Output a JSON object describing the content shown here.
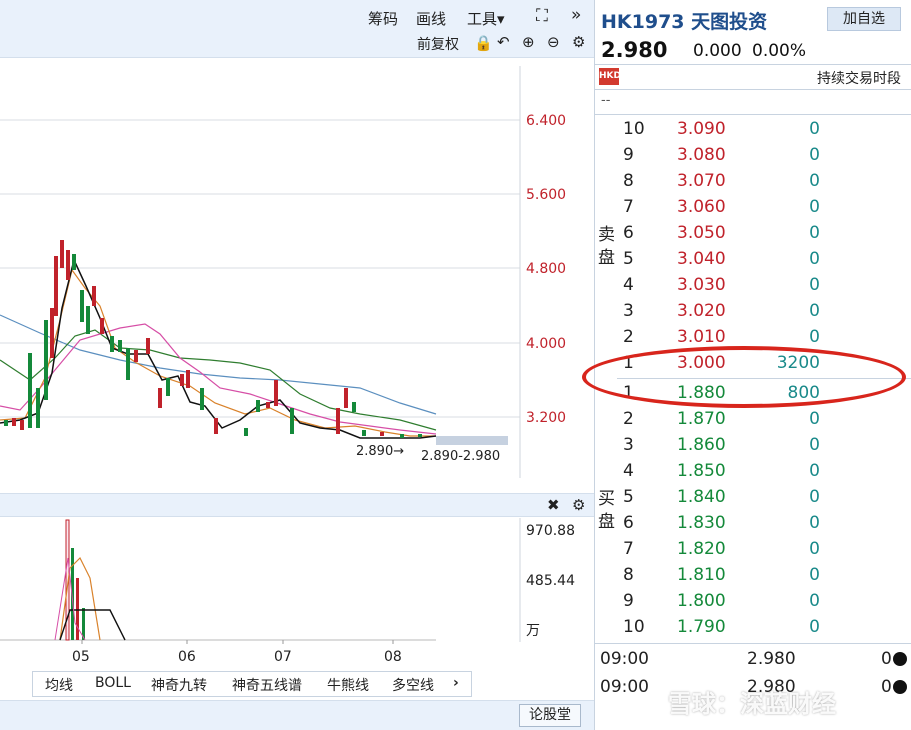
{
  "toolbar": {
    "chips_label": "筹码",
    "draw_label": "画线",
    "tools_label": "工具▾",
    "fuquan_label": "前复权"
  },
  "price_axis": {
    "ticks": [
      "6.400",
      "5.600",
      "4.800",
      "4.000",
      "3.200"
    ]
  },
  "annotations": {
    "low_label": "2.890→",
    "range_label": "2.890-2.980"
  },
  "volume_axis": {
    "ticks": [
      "970.88",
      "485.44",
      "万"
    ]
  },
  "months": [
    "05",
    "06",
    "07",
    "08"
  ],
  "indicator_tabs": [
    "均线",
    "BOLL",
    "神奇九转",
    "神奇五线谱",
    "牛熊线",
    "多空线"
  ],
  "bottom": {
    "lungutang_label": "论股堂"
  },
  "quote": {
    "code": "HK1973",
    "name": "天图投资",
    "add_label": "加自选",
    "price": "2.980",
    "change": "0.000",
    "change_pct": "0.00%",
    "currency_badge": "HKD",
    "session": "持续交易时段",
    "extra": "--"
  },
  "orderbook": {
    "sell_label": "卖盘",
    "buy_label": "买盘",
    "sell": [
      {
        "level": "10",
        "price": "3.090",
        "qty": "0"
      },
      {
        "level": "9",
        "price": "3.080",
        "qty": "0"
      },
      {
        "level": "8",
        "price": "3.070",
        "qty": "0"
      },
      {
        "level": "7",
        "price": "3.060",
        "qty": "0"
      },
      {
        "level": "6",
        "price": "3.050",
        "qty": "0"
      },
      {
        "level": "5",
        "price": "3.040",
        "qty": "0"
      },
      {
        "level": "4",
        "price": "3.030",
        "qty": "0"
      },
      {
        "level": "3",
        "price": "3.020",
        "qty": "0"
      },
      {
        "level": "2",
        "price": "3.010",
        "qty": "0"
      },
      {
        "level": "1",
        "price": "3.000",
        "qty": "3200"
      }
    ],
    "buy": [
      {
        "level": "1",
        "price": "1.880",
        "qty": "800"
      },
      {
        "level": "2",
        "price": "1.870",
        "qty": "0"
      },
      {
        "level": "3",
        "price": "1.860",
        "qty": "0"
      },
      {
        "level": "4",
        "price": "1.850",
        "qty": "0"
      },
      {
        "level": "5",
        "price": "1.840",
        "qty": "0"
      },
      {
        "level": "6",
        "price": "1.830",
        "qty": "0"
      },
      {
        "level": "7",
        "price": "1.820",
        "qty": "0"
      },
      {
        "level": "8",
        "price": "1.810",
        "qty": "0"
      },
      {
        "level": "9",
        "price": "1.800",
        "qty": "0"
      },
      {
        "level": "10",
        "price": "1.790",
        "qty": "0"
      }
    ]
  },
  "trades": [
    {
      "time": "09:00",
      "price": "2.980",
      "vol": "0"
    },
    {
      "time": "09:00",
      "price": "2.980",
      "vol": "0"
    }
  ],
  "watermark": "雪球：深蓝财经",
  "colors": {
    "up": "#c0222b",
    "down": "#14893a",
    "qty": "#1a8a8a",
    "highlight": "#d8251c",
    "header_bg": "#e9f1fb"
  }
}
